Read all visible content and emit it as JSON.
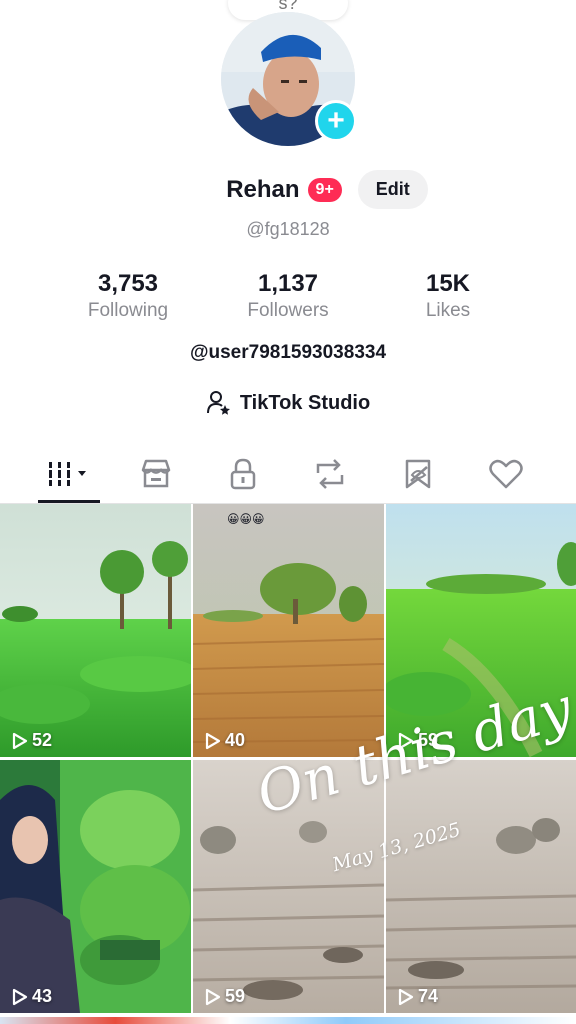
{
  "top_bubble": {
    "text": "s?"
  },
  "profile": {
    "name": "Rehan",
    "badge": "9+",
    "edit_label": "Edit",
    "handle": "@fg18128",
    "user_id": "@user7981593038334"
  },
  "stats": {
    "following": {
      "value": "3,753",
      "label": "Following"
    },
    "followers": {
      "value": "1,137",
      "label": "Followers"
    },
    "likes": {
      "value": "15K",
      "label": "Likes"
    }
  },
  "studio": {
    "label": "TikTok Studio",
    "icon": "person-star-icon"
  },
  "tabs": [
    {
      "icon": "videos-grid-icon",
      "active": true
    },
    {
      "icon": "shop-icon",
      "active": false
    },
    {
      "icon": "lock-icon",
      "active": false
    },
    {
      "icon": "repost-icon",
      "active": false
    },
    {
      "icon": "favorites-icon",
      "active": false
    },
    {
      "icon": "heart-icon",
      "active": false
    }
  ],
  "videos": [
    {
      "views": "52"
    },
    {
      "views": "40",
      "caption": "😀😀😀"
    },
    {
      "views": "59"
    },
    {
      "views": "43"
    },
    {
      "views": "59"
    },
    {
      "views": "74"
    }
  ],
  "memory_overlay": {
    "title": "On this day",
    "date": "May 13, 2025"
  },
  "colors": {
    "accent": "#fe2c55",
    "add_button": "#20d5ec",
    "text": "#161823",
    "muted": "#8a8b91"
  }
}
